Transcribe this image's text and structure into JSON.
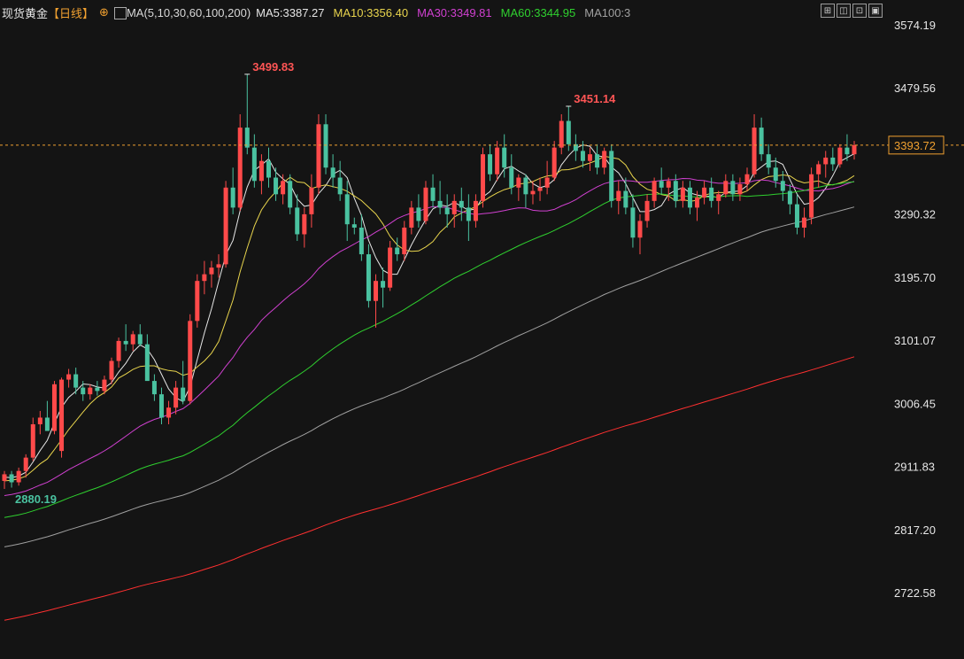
{
  "header": {
    "title": "现货黄金",
    "period": "【日线】",
    "plus_icon": "⊕",
    "ma_icon": "ma-settings-icon",
    "ma_label": "MA(5,10,30,60,100,200)",
    "ma_values": [
      {
        "label": "MA5:3387.27",
        "color": "#e6e6e6"
      },
      {
        "label": "MA10:3356.40",
        "color": "#e8d44d"
      },
      {
        "label": "MA30:3349.81",
        "color": "#d040d0"
      },
      {
        "label": "MA60:3344.95",
        "color": "#2fd02f"
      },
      {
        "label": "MA100:3",
        "color": "#a0a0a0"
      }
    ]
  },
  "toolbar": {
    "buttons": [
      {
        "name": "crosshair-icon",
        "glyph": "⊞"
      },
      {
        "name": "layout-icon",
        "glyph": "◫"
      },
      {
        "name": "fullscreen-icon",
        "glyph": "⊡"
      },
      {
        "name": "settings-icon",
        "glyph": "▣"
      }
    ]
  },
  "chart_data": {
    "type": "candlestick",
    "y_ticks": [
      "3574.19",
      "3479.56",
      "3290.32",
      "3195.70",
      "3101.07",
      "3006.45",
      "2911.83",
      "2817.20",
      "2722.58"
    ],
    "ylim": [
      2660,
      3600
    ],
    "current_price": "3393.72",
    "annotations": [
      {
        "text": "3499.83",
        "kind": "high"
      },
      {
        "text": "3451.14",
        "kind": "high"
      },
      {
        "text": "2880.19",
        "kind": "low"
      }
    ],
    "colors": {
      "up": "#ff4a4a",
      "down": "#4ac2a0",
      "bg": "#141414",
      "current_line": "#f0a030"
    },
    "candles": [
      [
        2890,
        2905,
        2878,
        2900
      ],
      [
        2900,
        2905,
        2880,
        2888
      ],
      [
        2888,
        2910,
        2883,
        2905
      ],
      [
        2905,
        2930,
        2895,
        2925
      ],
      [
        2925,
        2985,
        2920,
        2975
      ],
      [
        2975,
        2995,
        2960,
        2985
      ],
      [
        2985,
        3010,
        2970,
        2965
      ],
      [
        2965,
        3040,
        2960,
        3035
      ],
      [
        2935,
        3045,
        2925,
        3042
      ],
      [
        3042,
        3058,
        3030,
        3050
      ],
      [
        3050,
        3060,
        3020,
        3030
      ],
      [
        3030,
        3040,
        3010,
        3020
      ],
      [
        3020,
        3035,
        3012,
        3030
      ],
      [
        3030,
        3040,
        3018,
        3025
      ],
      [
        3025,
        3048,
        3020,
        3042
      ],
      [
        3042,
        3075,
        3035,
        3070
      ],
      [
        3070,
        3105,
        3060,
        3100
      ],
      [
        3100,
        3125,
        3085,
        3095
      ],
      [
        3095,
        3115,
        3085,
        3110
      ],
      [
        3110,
        3125,
        3092,
        3095
      ],
      [
        3095,
        3110,
        3060,
        3040
      ],
      [
        3040,
        3050,
        3010,
        3020
      ],
      [
        3020,
        3030,
        2975,
        2985
      ],
      [
        2985,
        3010,
        2975,
        3000
      ],
      [
        3000,
        3040,
        2990,
        3030
      ],
      [
        3030,
        3070,
        3005,
        3010
      ],
      [
        3010,
        3140,
        3005,
        3130
      ],
      [
        3130,
        3200,
        3120,
        3190
      ],
      [
        3190,
        3220,
        3170,
        3200
      ],
      [
        3200,
        3220,
        3180,
        3210
      ],
      [
        3210,
        3230,
        3195,
        3215
      ],
      [
        3215,
        3340,
        3210,
        3330
      ],
      [
        3330,
        3360,
        3290,
        3300
      ],
      [
        3300,
        3440,
        3295,
        3420
      ],
      [
        3420,
        3500,
        3380,
        3390
      ],
      [
        3390,
        3410,
        3330,
        3340
      ],
      [
        3340,
        3380,
        3320,
        3370
      ],
      [
        3370,
        3390,
        3330,
        3345
      ],
      [
        3345,
        3360,
        3310,
        3320
      ],
      [
        3320,
        3350,
        3305,
        3340
      ],
      [
        3340,
        3350,
        3290,
        3300
      ],
      [
        3300,
        3320,
        3250,
        3260
      ],
      [
        3260,
        3300,
        3240,
        3290
      ],
      [
        3290,
        3350,
        3270,
        3330
      ],
      [
        3330,
        3440,
        3320,
        3425
      ],
      [
        3425,
        3440,
        3350,
        3360
      ],
      [
        3360,
        3380,
        3330,
        3345
      ],
      [
        3345,
        3370,
        3310,
        3320
      ],
      [
        3320,
        3340,
        3250,
        3275
      ],
      [
        3275,
        3285,
        3260,
        3270
      ],
      [
        3270,
        3290,
        3220,
        3230
      ],
      [
        3230,
        3245,
        3150,
        3160
      ],
      [
        3160,
        3200,
        3120,
        3190
      ],
      [
        3190,
        3210,
        3150,
        3180
      ],
      [
        3180,
        3250,
        3175,
        3240
      ],
      [
        3240,
        3255,
        3220,
        3230
      ],
      [
        3230,
        3280,
        3220,
        3270
      ],
      [
        3270,
        3310,
        3260,
        3300
      ],
      [
        3300,
        3320,
        3270,
        3280
      ],
      [
        3280,
        3340,
        3275,
        3330
      ],
      [
        3330,
        3350,
        3300,
        3310
      ],
      [
        3310,
        3340,
        3290,
        3300
      ],
      [
        3300,
        3320,
        3270,
        3290
      ],
      [
        3290,
        3320,
        3270,
        3310
      ],
      [
        3310,
        3330,
        3280,
        3300
      ],
      [
        3300,
        3320,
        3250,
        3280
      ],
      [
        3280,
        3320,
        3270,
        3310
      ],
      [
        3310,
        3390,
        3300,
        3380
      ],
      [
        3380,
        3395,
        3340,
        3350
      ],
      [
        3350,
        3400,
        3340,
        3390
      ],
      [
        3390,
        3410,
        3345,
        3360
      ],
      [
        3360,
        3380,
        3320,
        3330
      ],
      [
        3330,
        3350,
        3310,
        3345
      ],
      [
        3345,
        3350,
        3300,
        3320
      ],
      [
        3320,
        3340,
        3305,
        3325
      ],
      [
        3325,
        3345,
        3310,
        3330
      ],
      [
        3330,
        3370,
        3320,
        3345
      ],
      [
        3345,
        3400,
        3340,
        3390
      ],
      [
        3390,
        3440,
        3380,
        3430
      ],
      [
        3430,
        3452,
        3385,
        3395
      ],
      [
        3395,
        3410,
        3370,
        3385
      ],
      [
        3385,
        3400,
        3360,
        3370
      ],
      [
        3370,
        3390,
        3355,
        3380
      ],
      [
        3380,
        3395,
        3350,
        3360
      ],
      [
        3360,
        3390,
        3350,
        3385
      ],
      [
        3385,
        3395,
        3300,
        3310
      ],
      [
        3310,
        3340,
        3290,
        3325
      ],
      [
        3325,
        3345,
        3290,
        3300
      ],
      [
        3300,
        3320,
        3240,
        3255
      ],
      [
        3255,
        3290,
        3230,
        3280
      ],
      [
        3280,
        3320,
        3270,
        3310
      ],
      [
        3310,
        3345,
        3300,
        3340
      ],
      [
        3340,
        3360,
        3320,
        3330
      ],
      [
        3330,
        3345,
        3310,
        3340
      ],
      [
        3340,
        3350,
        3300,
        3310
      ],
      [
        3310,
        3340,
        3300,
        3330
      ],
      [
        3330,
        3340,
        3290,
        3300
      ],
      [
        3300,
        3325,
        3280,
        3315
      ],
      [
        3315,
        3340,
        3305,
        3330
      ],
      [
        3330,
        3345,
        3300,
        3310
      ],
      [
        3310,
        3325,
        3290,
        3320
      ],
      [
        3320,
        3350,
        3315,
        3340
      ],
      [
        3340,
        3350,
        3310,
        3320
      ],
      [
        3320,
        3345,
        3310,
        3335
      ],
      [
        3335,
        3360,
        3325,
        3350
      ],
      [
        3350,
        3440,
        3345,
        3420
      ],
      [
        3420,
        3435,
        3370,
        3380
      ],
      [
        3380,
        3395,
        3350,
        3360
      ],
      [
        3360,
        3375,
        3330,
        3340
      ],
      [
        3340,
        3355,
        3310,
        3325
      ],
      [
        3325,
        3335,
        3290,
        3305
      ],
      [
        3305,
        3320,
        3260,
        3270
      ],
      [
        3270,
        3300,
        3255,
        3285
      ],
      [
        3285,
        3360,
        3275,
        3350
      ],
      [
        3350,
        3370,
        3330,
        3365
      ],
      [
        3365,
        3385,
        3345,
        3375
      ],
      [
        3375,
        3390,
        3355,
        3365
      ],
      [
        3365,
        3395,
        3360,
        3390
      ],
      [
        3390,
        3410,
        3370,
        3380
      ],
      [
        3380,
        3400,
        3372,
        3393.72
      ]
    ]
  }
}
